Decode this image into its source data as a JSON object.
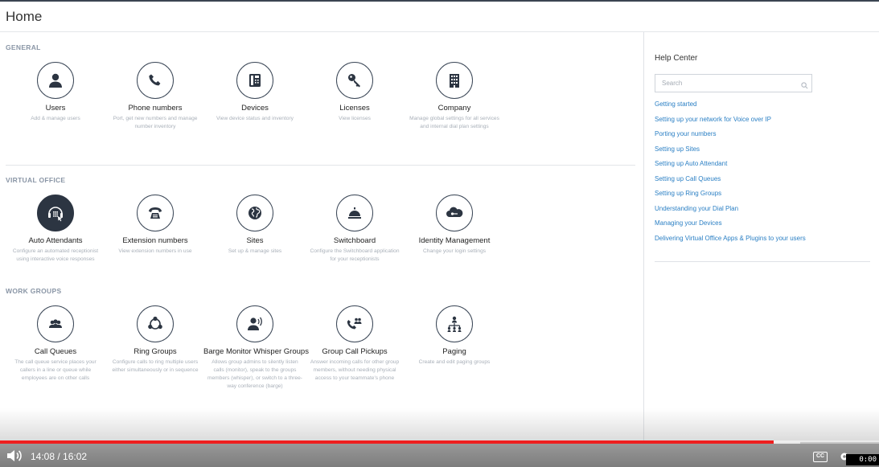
{
  "header": {
    "title": "Home"
  },
  "sections": {
    "general": {
      "label": "GENERAL"
    },
    "virtual_office": {
      "label": "VIRTUAL OFFICE"
    },
    "work_groups": {
      "label": "WORK GROUPS"
    }
  },
  "tiles": {
    "users": {
      "title": "Users",
      "desc": "Add & manage users",
      "icon": "user-icon"
    },
    "phone_numbers": {
      "title": "Phone numbers",
      "desc": "Port, get new numbers and manage number inventory",
      "icon": "phone-icon"
    },
    "devices": {
      "title": "Devices",
      "desc": "View device status and inventory",
      "icon": "desk-phone-icon"
    },
    "licenses": {
      "title": "Licenses",
      "desc": "View licenses",
      "icon": "key-icon"
    },
    "company": {
      "title": "Company",
      "desc": "Manage global settings for all services and internal dial plan settings",
      "icon": "building-icon"
    },
    "auto_attendants": {
      "title": "Auto Attendants",
      "desc": "Configure an automated receptionist using interactive voice responses",
      "icon": "auto-attendant-icon"
    },
    "extension_numbers": {
      "title": "Extension numbers",
      "desc": "View extension numbers in use",
      "icon": "rotary-phone-icon"
    },
    "sites": {
      "title": "Sites",
      "desc": "Set up & manage sites",
      "icon": "globe-icon"
    },
    "switchboard": {
      "title": "Switchboard",
      "desc": "Configure the Switchboard application for your receptionists",
      "icon": "service-bell-icon"
    },
    "identity_management": {
      "title": "Identity Management",
      "desc": "Change your login settings",
      "icon": "cloud-key-icon"
    },
    "call_queues": {
      "title": "Call Queues",
      "desc": "The call queue service places your callers in a line or queue while employees are on other calls",
      "icon": "group-icon"
    },
    "ring_groups": {
      "title": "Ring Groups",
      "desc": "Configure calls to ring multiple users either simultaneously or in sequence",
      "icon": "ring-group-icon"
    },
    "barge_monitor": {
      "title": "Barge Monitor Whisper Groups",
      "desc": "Allows group admins to silently listen calls (monitor), speak to the groups members (whisper), or switch to a three-way conference (barge)",
      "icon": "listener-icon"
    },
    "group_call_pickups": {
      "title": "Group Call Pickups",
      "desc": "Answer incoming calls for other group members, without needing physical access to your teammate's phone",
      "icon": "phone-group-icon"
    },
    "paging": {
      "title": "Paging",
      "desc": "Create and edit paging groups",
      "icon": "paging-icon"
    }
  },
  "help_center": {
    "title": "Help Center",
    "search_placeholder": "Search",
    "links": [
      "Getting started",
      "Setting up your network for Voice over IP",
      "Porting your numbers",
      "Setting up Sites",
      "Setting up Auto Attendant",
      "Setting up Call Queues",
      "Setting up Ring Groups",
      "Understanding your Dial Plan",
      "Managing your Devices",
      "Delivering Virtual Office Apps & Plugins to your users"
    ]
  },
  "player": {
    "time": "14:08 / 16:02",
    "progress": 0.88,
    "buffered": 0.91,
    "cc_label": "CC",
    "timecode": "0:00",
    "accent": "#ee1f1f"
  }
}
